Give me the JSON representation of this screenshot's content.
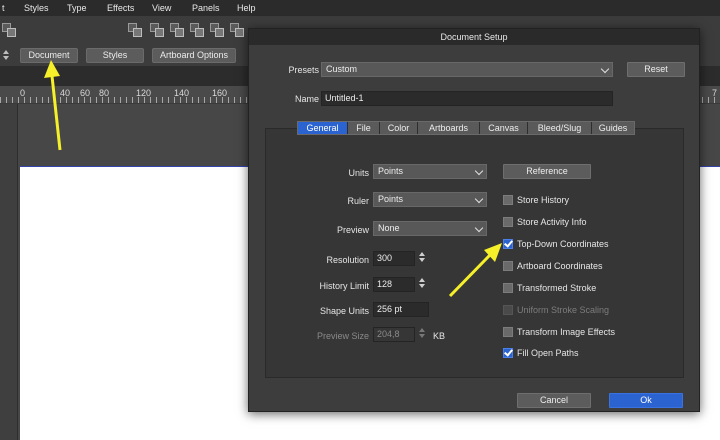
{
  "menu": [
    "t",
    "Styles",
    "Type",
    "Effects",
    "View",
    "Panels",
    "Help"
  ],
  "context_toolbar": {
    "document_label": "Document",
    "styles_label": "Styles",
    "artboard_options_label": "Artboard Options"
  },
  "ruler": [
    "0",
    "40",
    "60",
    "80",
    "120",
    "140",
    "160",
    "7"
  ],
  "dialog": {
    "title": "Document Setup",
    "presets_label": "Presets",
    "presets_value": "Custom",
    "reset_label": "Reset",
    "name_label": "Name",
    "name_value": "Untitled-1",
    "tabs": [
      {
        "label": "General",
        "active": true
      },
      {
        "label": "File"
      },
      {
        "label": "Color"
      },
      {
        "label": "Artboards"
      },
      {
        "label": "Canvas"
      },
      {
        "label": "Bleed/Slug"
      },
      {
        "label": "Guides"
      }
    ],
    "units_label": "Units",
    "units_value": "Points",
    "ruler_label": "Ruler",
    "ruler_value": "Points",
    "preview_label": "Preview",
    "preview_value": "None",
    "resolution_label": "Resolution",
    "resolution_value": "300",
    "history_label": "History Limit",
    "history_value": "128",
    "shape_units_label": "Shape Units",
    "shape_units_value": "256 pt",
    "preview_size_label": "Preview Size",
    "preview_size_value": "204,8",
    "preview_size_unit": "KB",
    "reference_label": "Reference",
    "checkboxes": [
      {
        "label": "Store History",
        "checked": false,
        "enabled": true
      },
      {
        "label": "Store Activity Info",
        "checked": false,
        "enabled": true
      },
      {
        "label": "Top-Down Coordinates",
        "checked": true,
        "enabled": true
      },
      {
        "label": "Artboard Coordinates",
        "checked": false,
        "enabled": true
      },
      {
        "label": "Transformed Stroke",
        "checked": false,
        "enabled": true
      },
      {
        "label": "Uniform Stroke Scaling",
        "checked": false,
        "enabled": false
      },
      {
        "label": "Transform Image Effects",
        "checked": false,
        "enabled": true
      },
      {
        "label": "Fill Open Paths",
        "checked": true,
        "enabled": true
      }
    ],
    "cancel_label": "Cancel",
    "ok_label": "Ok"
  },
  "colors": {
    "accent": "#2b63d0",
    "annotation_arrow": "#f5f02a"
  }
}
